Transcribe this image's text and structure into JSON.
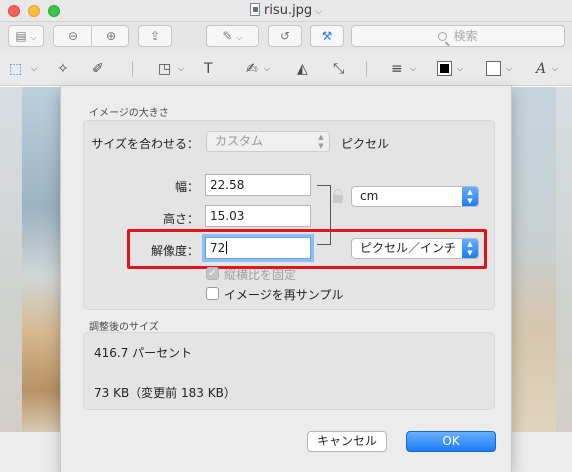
{
  "window": {
    "title": "risu.jpg",
    "title_chevron": "⌵"
  },
  "toolbar": {
    "sidebar_glyph": "▤",
    "zoom_out_glyph": "⊖",
    "zoom_in_glyph": "⊕",
    "share_glyph": "⇪",
    "markup_glyph": "✎",
    "rotate_glyph": "↺",
    "toolbox_glyph": "⚒",
    "search_placeholder": "検索"
  },
  "markup_toolbar": {
    "select_glyph": "⬚",
    "instant_alpha_glyph": "✧",
    "sketch_glyph": "✐",
    "shapes_glyph": "◳",
    "text_glyph": "T",
    "sign_glyph": "✍",
    "adjust_color_glyph": "◭",
    "adjust_size_glyph": "⤡",
    "shape_style_glyph": "≡",
    "border_color": "#000000",
    "fill_color": "#ffffff",
    "text_style_glyph": "A",
    "chevron": "⌵"
  },
  "dialog": {
    "section_image_size": "イメージの大きさ",
    "fit_into_label": "サイズを合わせる：",
    "fit_into_value": "カスタム",
    "fit_into_unit": "ピクセル",
    "width_label": "幅：",
    "width_value": "22.58",
    "height_label": "高さ：",
    "height_value": "15.03",
    "resolution_label": "解像度：",
    "resolution_value": "72",
    "unit_value": "cm",
    "resolution_unit_value": "ピクセル／インチ",
    "scale_proportionally_label": "縦横比を固定",
    "scale_proportionally_checked": true,
    "resample_label": "イメージを再サンプル",
    "resample_checked": false,
    "section_resulting_size": "調整後のサイズ",
    "result_percent": "416.7 パーセント",
    "result_filesize": "73 KB（変更前 183 KB）",
    "cancel_label": "キャンセル",
    "ok_label": "OK",
    "highlight_color": "#e2141a",
    "accent_color": "#1b7df6"
  }
}
